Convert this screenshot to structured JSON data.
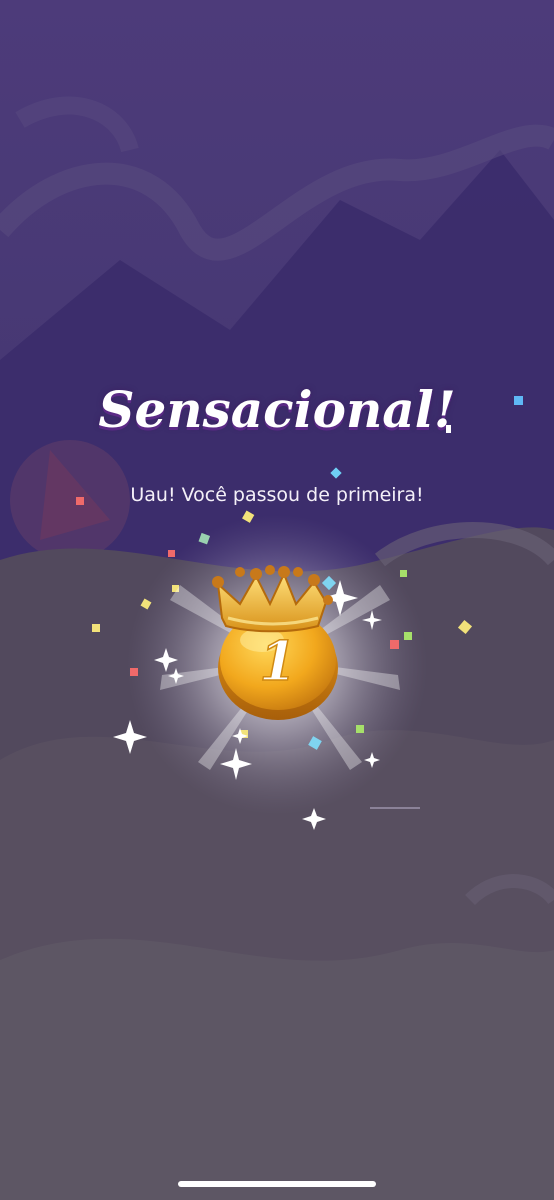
{
  "screen": {
    "title": "Sensacional!",
    "subtitle": "Uau! Você passou de primeira!",
    "badge_number": "1",
    "badge_icon": "crown-medal-icon"
  },
  "colors": {
    "sky": "#4b3b78",
    "mountain": "#3a2a6e",
    "overlay": "#50485a",
    "gold": "#f2a81d",
    "title_shadow": "#5b2a86"
  }
}
